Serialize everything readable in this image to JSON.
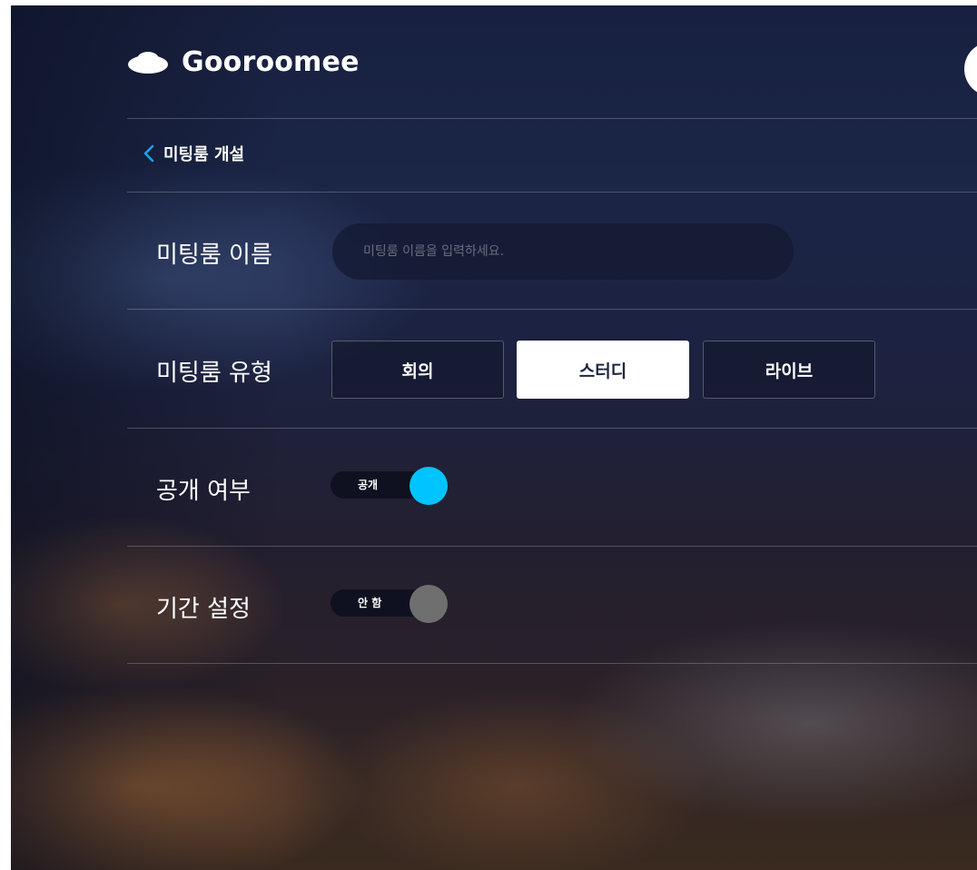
{
  "header": {
    "brand": "Gooroomee",
    "logo_icon": "cloud-icon",
    "avatar_icon": "profile-avatar"
  },
  "nav": {
    "back_icon": "chevron-left-icon",
    "back_label": "미팅룸 개설"
  },
  "form": {
    "room_name": {
      "label": "미팅룸 이름",
      "value": "",
      "placeholder": "미팅룸 이름을 입력하세요."
    },
    "room_type": {
      "label": "미팅룸 유형",
      "options": [
        "회의",
        "스터디",
        "라이브"
      ],
      "selected": "스터디"
    },
    "visibility": {
      "label": "공개 여부",
      "toggle_text": "공개",
      "on": true
    },
    "period": {
      "label": "기간 설정",
      "toggle_text": "안 함",
      "on": false
    }
  },
  "colors": {
    "toggle_on": "#00c4ff",
    "toggle_off": "#6f6f6f",
    "back_chevron": "#1fa0ff",
    "selected_button_bg": "#ffffff"
  }
}
